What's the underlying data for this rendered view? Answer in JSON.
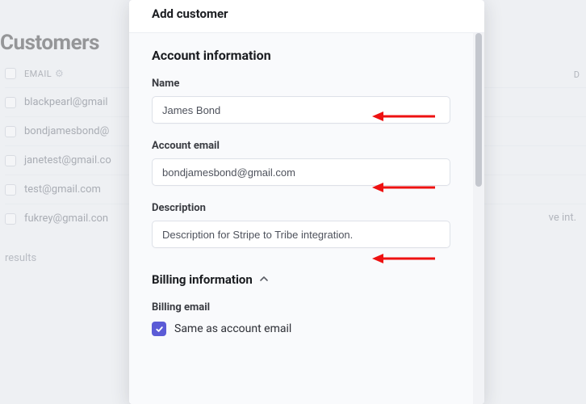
{
  "background": {
    "title": "Customers",
    "column_label": "EMAIL",
    "rows": [
      {
        "email": "blackpearl@gmail"
      },
      {
        "email": "bondjamesbond@"
      },
      {
        "email": "janetest@gmail.co"
      },
      {
        "email": "test@gmail.com"
      },
      {
        "email": "fukrey@gmail.con"
      }
    ],
    "results_label": "results",
    "right_truncated": "ve int.",
    "right_header": "D"
  },
  "modal": {
    "title": "Add customer",
    "account_title": "Account information",
    "fields": {
      "name_label": "Name",
      "name_value": "James Bond",
      "email_label": "Account email",
      "email_value": "bondjamesbond@gmail.com",
      "description_label": "Description",
      "description_value": "Description for Stripe to Tribe integration."
    },
    "billing": {
      "title": "Billing information",
      "email_label": "Billing email",
      "same_as_label": "Same as account email",
      "same_as_checked": true
    }
  }
}
